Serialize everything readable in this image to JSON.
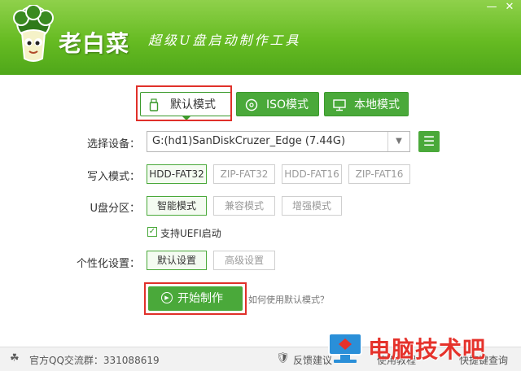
{
  "header": {
    "app_name": "老白菜",
    "slogan": "超级U盘启动制作工具",
    "minimize_label": "—",
    "close_label": "✕"
  },
  "modes": {
    "default_label": "默认模式",
    "iso_label": "ISO模式",
    "local_label": "本地模式",
    "default_icon": "usb-drive-icon",
    "iso_icon": "disc-icon",
    "local_icon": "monitor-icon"
  },
  "device": {
    "label": "选择设备：",
    "value": "G:(hd1)SanDiskCruzer_Edge (7.44G)"
  },
  "write_mode": {
    "label": "写入模式：",
    "options": [
      "HDD-FAT32",
      "ZIP-FAT32",
      "HDD-FAT16",
      "ZIP-FAT16"
    ],
    "selected": "HDD-FAT32"
  },
  "partition": {
    "label": "U盘分区：",
    "options": [
      "智能模式",
      "兼容模式",
      "增强模式"
    ],
    "selected": "智能模式"
  },
  "uefi": {
    "label": "支持UEFI启动",
    "checked": true
  },
  "personalize": {
    "label": "个性化设置：",
    "options": [
      "默认设置",
      "高级设置"
    ],
    "selected": "默认设置"
  },
  "actions": {
    "start_label": "开始制作",
    "help_link": "如何使用默认模式？"
  },
  "footer": {
    "qq_group": "官方QQ交流群：331088619",
    "feedback": "反馈建议",
    "tutorial": "使用教程",
    "shortcut": "快捷键查询"
  },
  "watermark": {
    "text": "电脑技术吧"
  },
  "colors": {
    "brand_green": "#4aa93a",
    "header_green": "#66bb22",
    "highlight_red": "#e0302a",
    "watermark_red": "#e5322b"
  }
}
